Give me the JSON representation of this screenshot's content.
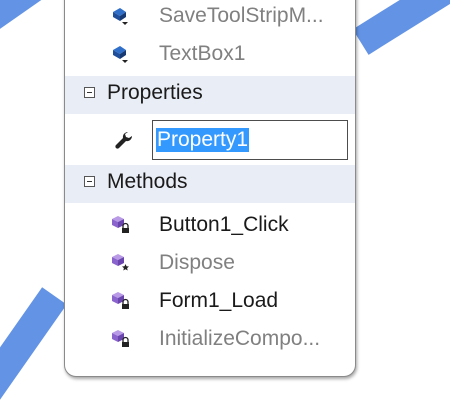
{
  "members": {
    "fields": [
      {
        "label": "SaveToolStripM...",
        "icon": "field-icon",
        "muted": true
      },
      {
        "label": "TextBox1",
        "icon": "field-icon",
        "muted": true
      }
    ],
    "properties": {
      "header": "Properties",
      "items": [
        {
          "label": "Property1",
          "icon": "wrench-icon",
          "editing": true
        }
      ]
    },
    "methods": {
      "header": "Methods",
      "items": [
        {
          "label": "Button1_Click",
          "icon": "method-private-icon",
          "muted": false
        },
        {
          "label": "Dispose",
          "icon": "method-protected-icon",
          "muted": true
        },
        {
          "label": "Form1_Load",
          "icon": "method-private-icon",
          "muted": false
        },
        {
          "label": "InitializeCompo...",
          "icon": "method-private-icon",
          "muted": true
        }
      ]
    }
  },
  "colors": {
    "selection": "#3399ff",
    "section_background": "#e9edf5",
    "muted_text": "#808080",
    "accent_stripes": "#5b8de3"
  }
}
